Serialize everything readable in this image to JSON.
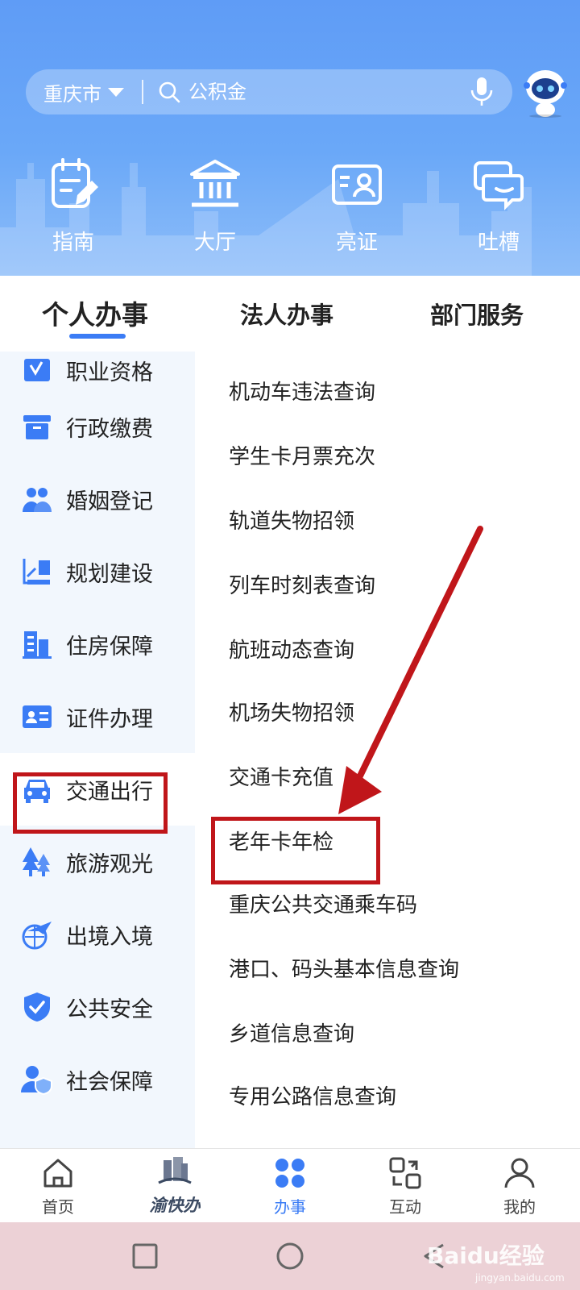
{
  "header": {
    "city": "重庆市",
    "search_placeholder": "公积金",
    "quick_links": [
      {
        "label": "指南",
        "icon": "guide-icon"
      },
      {
        "label": "大厅",
        "icon": "hall-icon"
      },
      {
        "label": "亮证",
        "icon": "id-card-icon"
      },
      {
        "label": "吐槽",
        "icon": "feedback-icon"
      }
    ]
  },
  "tabs": [
    {
      "label": "个人办事",
      "active": true
    },
    {
      "label": "法人办事",
      "active": false
    },
    {
      "label": "部门服务",
      "active": false
    }
  ],
  "left_menu": [
    {
      "label": "职业资格",
      "icon": "certificate-icon"
    },
    {
      "label": "行政缴费",
      "icon": "payment-box-icon"
    },
    {
      "label": "婚姻登记",
      "icon": "couple-icon"
    },
    {
      "label": "规划建设",
      "icon": "planning-icon"
    },
    {
      "label": "住房保障",
      "icon": "building-icon"
    },
    {
      "label": "证件办理",
      "icon": "id-document-icon"
    },
    {
      "label": "交通出行",
      "icon": "car-icon",
      "selected": true
    },
    {
      "label": "旅游观光",
      "icon": "trees-icon"
    },
    {
      "label": "出境入境",
      "icon": "plane-globe-icon"
    },
    {
      "label": "公共安全",
      "icon": "shield-check-icon"
    },
    {
      "label": "社会保障",
      "icon": "person-shield-icon"
    }
  ],
  "services": [
    "机动车违法查询",
    "学生卡月票充次",
    "轨道失物招领",
    "列车时刻表查询",
    "航班动态查询",
    "机场失物招领",
    "交通卡充值",
    "老年卡年检",
    "重庆公共交通乘车码",
    "港口、码头基本信息查询",
    "乡道信息查询",
    "专用公路信息查询"
  ],
  "bottom_nav": [
    {
      "label": "首页",
      "icon": "home-icon"
    },
    {
      "label": "渝快办",
      "icon": "yukuaiban-logo"
    },
    {
      "label": "办事",
      "icon": "services-grid-icon",
      "active": true
    },
    {
      "label": "互动",
      "icon": "interact-icon"
    },
    {
      "label": "我的",
      "icon": "profile-icon"
    }
  ],
  "watermark": {
    "text": "Baidu经验",
    "sub": "jingyan.baidu.com"
  },
  "colors": {
    "accent": "#3b7cf5",
    "highlight_box": "#c0161a",
    "header_blue": "#6aa8f8"
  }
}
